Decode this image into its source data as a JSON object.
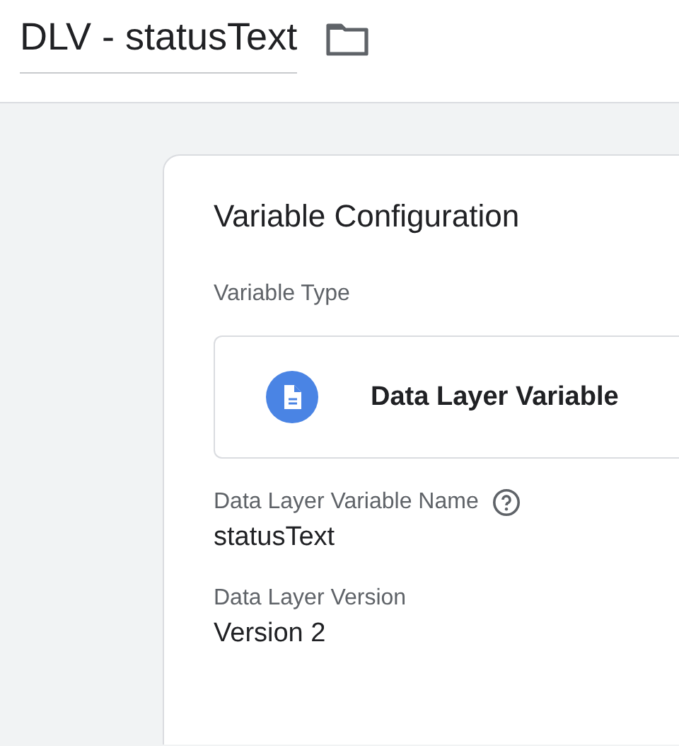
{
  "header": {
    "title": "DLV - statusText"
  },
  "card": {
    "title": "Variable Configuration",
    "type_label": "Variable Type",
    "type_value": "Data Layer Variable",
    "fields": [
      {
        "label": "Data Layer Variable Name",
        "help": true,
        "value": "statusText"
      },
      {
        "label": "Data Layer Version",
        "help": false,
        "value": "Version 2"
      }
    ]
  }
}
